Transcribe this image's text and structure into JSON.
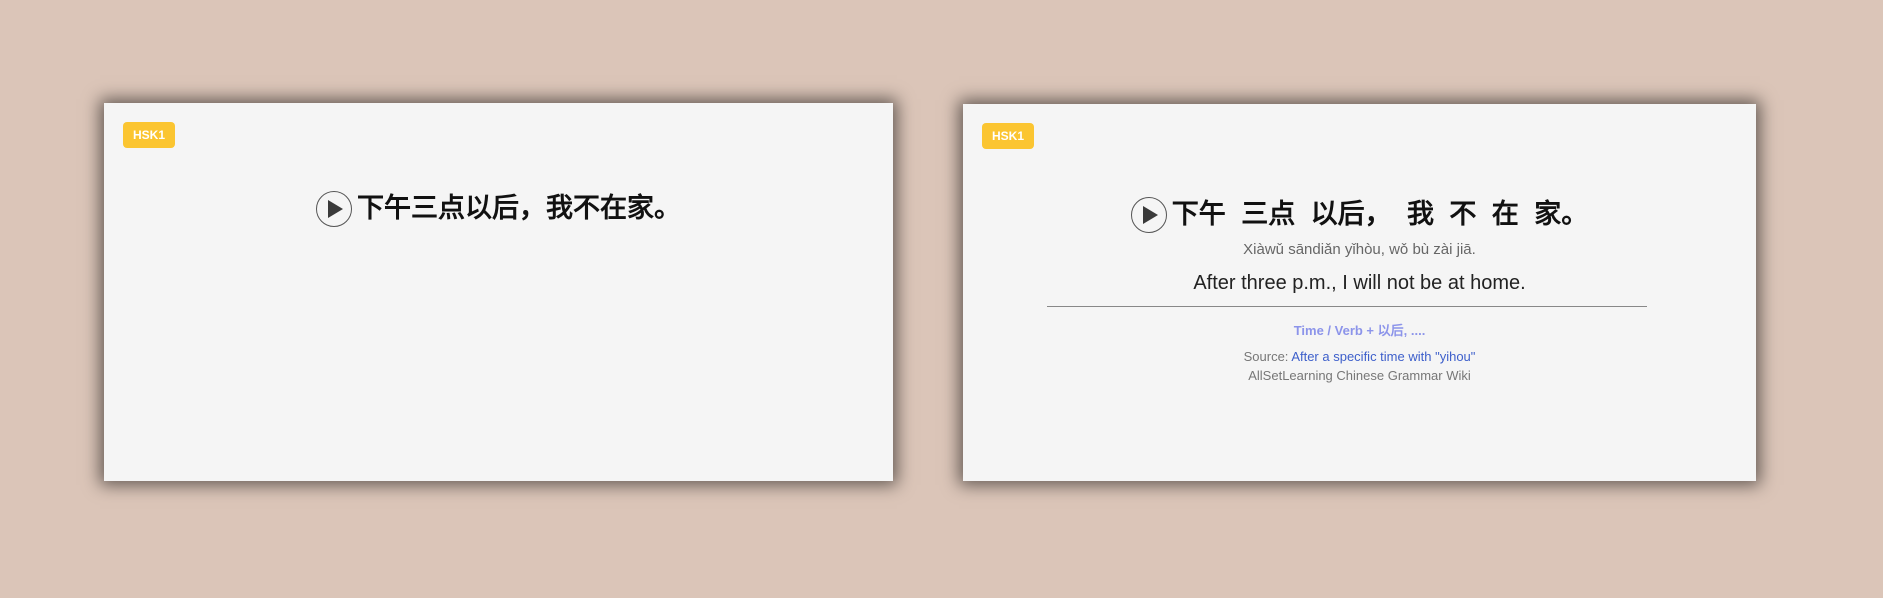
{
  "colors": {
    "background": "#dbc5b8",
    "card": "#f5f5f5",
    "badge": "#fbc531",
    "pattern_link": "#8c94ea",
    "source_link": "#3d5fcb"
  },
  "front_card": {
    "badge": "HSK1",
    "play_icon": "play-icon",
    "hanzi": "下午三点以后，我不在家。"
  },
  "back_card": {
    "badge": "HSK1",
    "play_icon": "play-icon",
    "hanzi": "下午 三点 以后， 我 不 在 家。",
    "pinyin": "Xiàwǔ sāndiǎn yǐhòu, wǒ bù zài jiā.",
    "translation": "After three p.m., I will not be at home.",
    "pattern": "Time / Verb + 以后, ....",
    "source_label": "Source: ",
    "source_link": "After a specific time with \"yihou\"",
    "wiki": "AllSetLearning Chinese Grammar Wiki"
  }
}
